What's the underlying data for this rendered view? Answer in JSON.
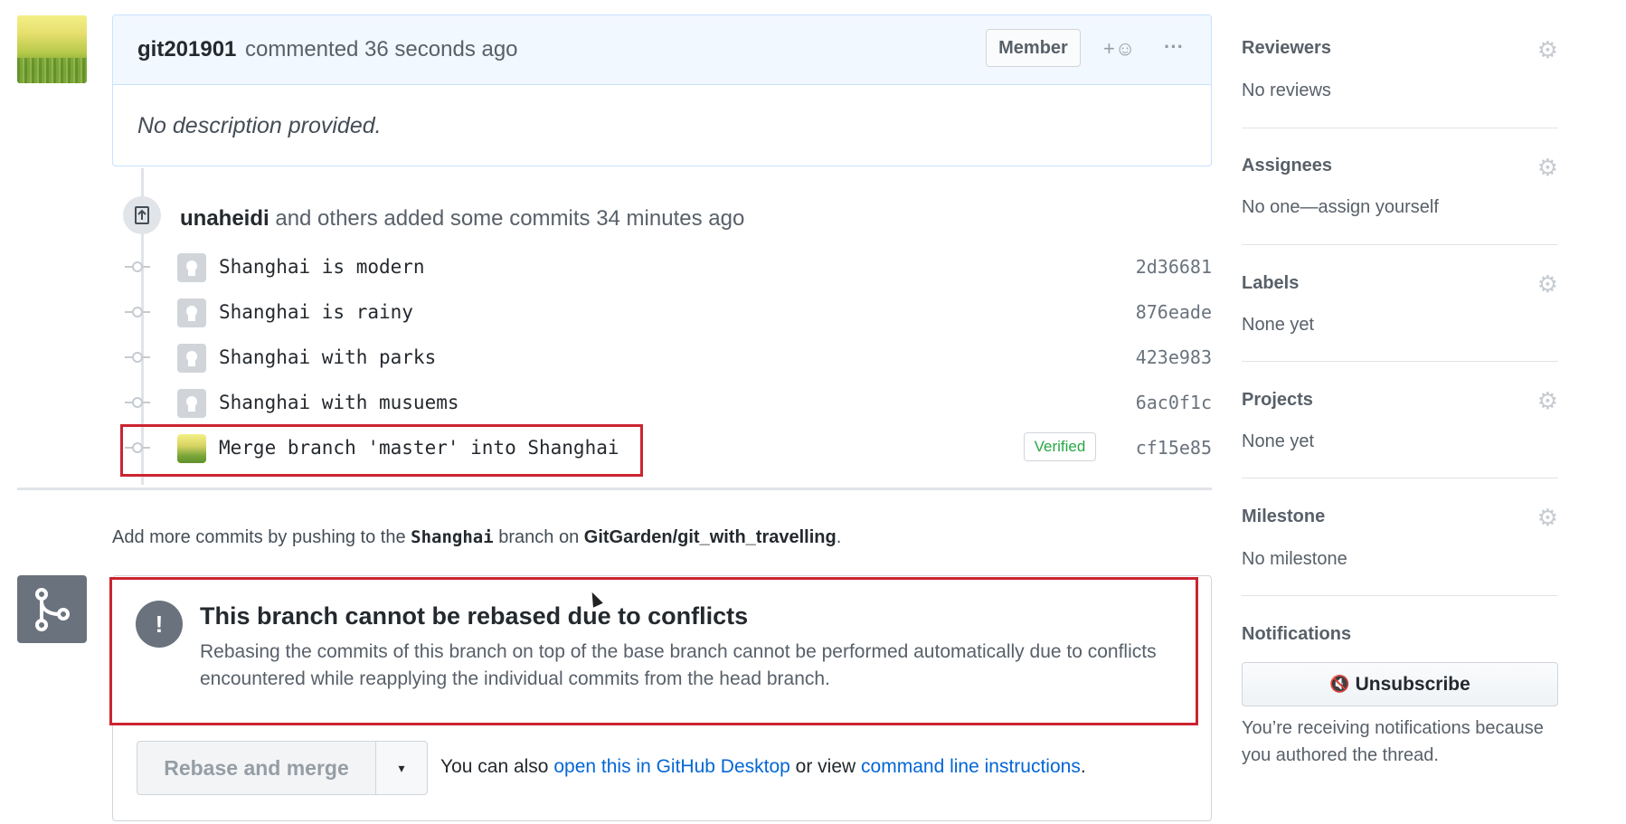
{
  "comment": {
    "author": "git201901",
    "action": "commented 36 seconds ago",
    "badge": "Member",
    "reaction_label": "+☺",
    "more_label": "···",
    "body": "No description provided."
  },
  "push_event": {
    "author": "unaheidi",
    "text": "and others added some commits 34 minutes ago"
  },
  "commits": [
    {
      "message": "Shanghai is modern",
      "sha": "2d36681",
      "verified": ""
    },
    {
      "message": "Shanghai is rainy",
      "sha": "876eade",
      "verified": ""
    },
    {
      "message": "Shanghai with parks",
      "sha": "423e983",
      "verified": ""
    },
    {
      "message": "Shanghai with musuems",
      "sha": "6ac0f1c",
      "verified": ""
    },
    {
      "message": "Merge branch 'master' into Shanghai",
      "sha": "cf15e85",
      "verified": "Verified"
    }
  ],
  "push_hint": {
    "prefix": "Add more commits by pushing to the",
    "branch": "Shanghai",
    "middle": "branch on",
    "repo": "GitGarden/git_with_travelling",
    "suffix": "."
  },
  "conflict": {
    "icon": "!",
    "title": "This branch cannot be rebased due to conflicts",
    "description": "Rebasing the commits of this branch on top of the base branch cannot be performed automatically due to conflicts encountered while reapplying the individual commits from the head branch."
  },
  "merge_actions": {
    "button_label": "Rebase and merge",
    "caret": "▾",
    "also_prefix": "You can also",
    "desktop_link": "open this in GitHub Desktop",
    "or_view": "or view",
    "cli_link": "command line instructions",
    "suffix": "."
  },
  "sidebar": {
    "reviewers": {
      "title": "Reviewers",
      "value": "No reviews"
    },
    "assignees": {
      "title": "Assignees",
      "value": "No one—assign yourself"
    },
    "labels": {
      "title": "Labels",
      "value": "None yet"
    },
    "projects": {
      "title": "Projects",
      "value": "None yet"
    },
    "milestone": {
      "title": "Milestone",
      "value": "No milestone"
    },
    "notifications": {
      "title": "Notifications",
      "button_label": "Unsubscribe",
      "button_icon": "🔇",
      "text": "You’re receiving notifications because you authored the thread."
    }
  },
  "colors": {
    "conflict_highlight": "#cb2431",
    "link": "#0366d6",
    "verified": "#28a745",
    "header_bg": "#f1f8ff"
  }
}
